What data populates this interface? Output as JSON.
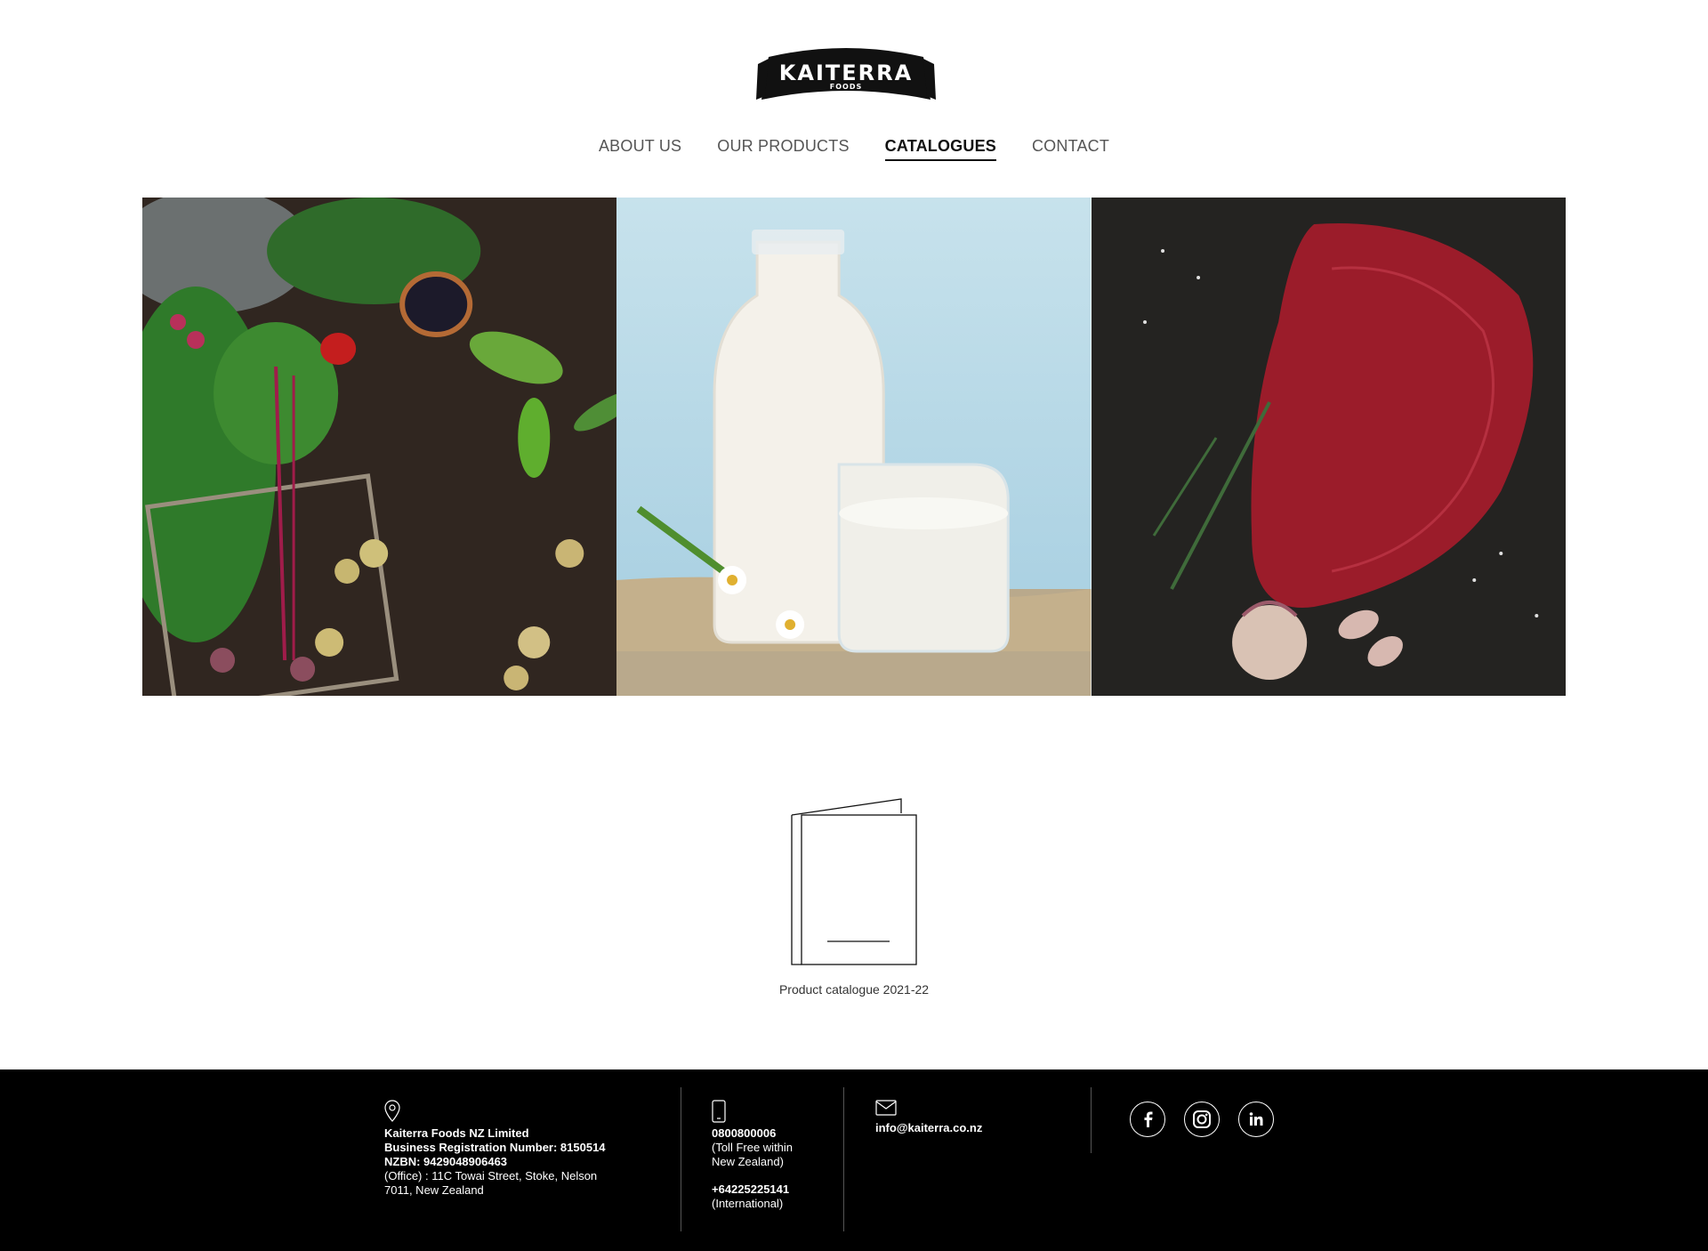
{
  "brand": {
    "name": "KAITERRA",
    "sub": "FOODS"
  },
  "nav": [
    {
      "label": "ABOUT US"
    },
    {
      "label": "OUR PRODUCTS"
    },
    {
      "label": "CATALOGUES",
      "active": true
    },
    {
      "label": "CONTACT"
    }
  ],
  "hero": {
    "panels": [
      "vegetables",
      "milk",
      "meat"
    ]
  },
  "catalogue": {
    "label": "Product catalogue 2021-22"
  },
  "footer": {
    "address": {
      "company": "Kaiterra Foods NZ Limited",
      "brn": "Business Registration Number: 8150514",
      "nzbn": "NZBN: 9429048906463",
      "office_line1": "(Office) : 11C Towai Street, Stoke, Nelson",
      "office_line2": "7011, New Zealand"
    },
    "phone": {
      "tollfree": "0800800006",
      "tollfree_note1": "(Toll Free within",
      "tollfree_note2": "New Zealand)",
      "intl": "+64225225141",
      "intl_note": "(International)"
    },
    "email": "info@kaiterra.co.nz",
    "social": [
      "facebook-icon",
      "instagram-icon",
      "linkedin-icon"
    ]
  },
  "colors": {
    "footer_bg": "#000000",
    "active_nav": "#111111"
  }
}
